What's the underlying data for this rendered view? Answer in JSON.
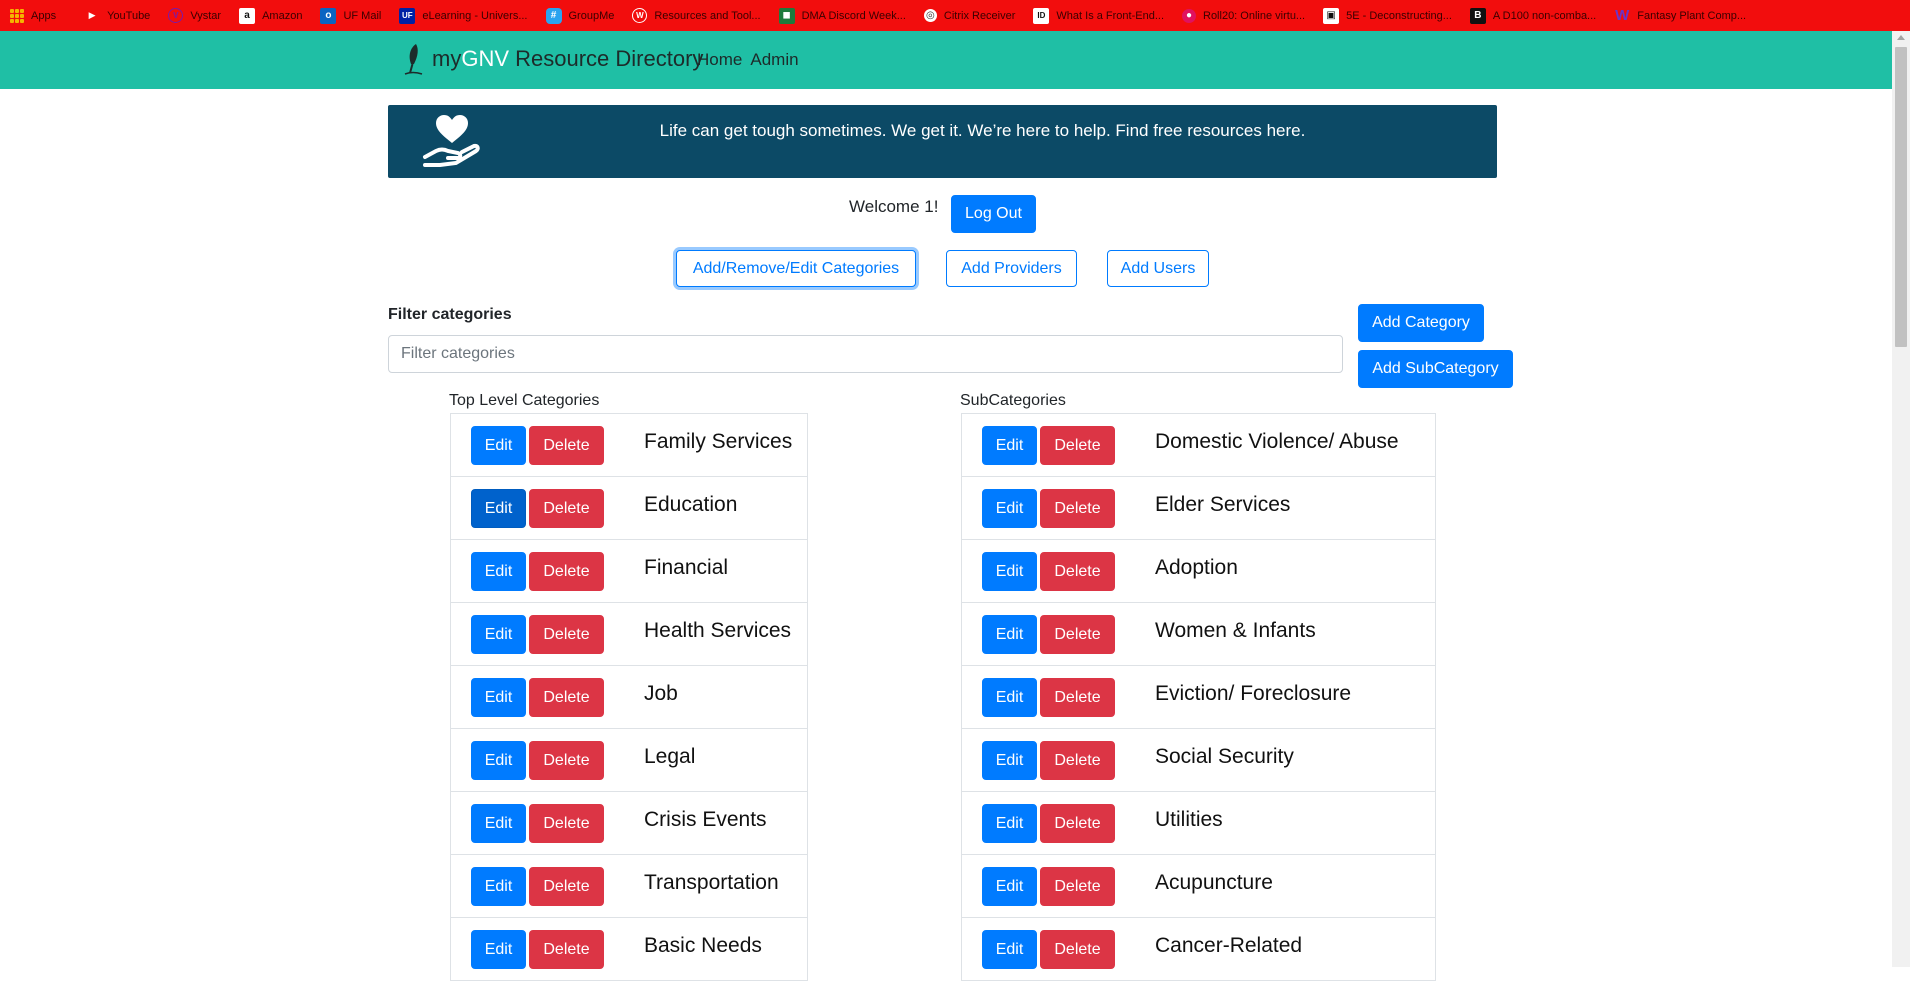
{
  "bookmarks": [
    {
      "label": "Apps",
      "icon": "apps-grid-icon"
    },
    {
      "label": "YouTube",
      "icon": "youtube-icon"
    },
    {
      "label": "Vystar",
      "icon": "vystar-icon"
    },
    {
      "label": "Amazon",
      "icon": "amazon-icon"
    },
    {
      "label": "UF Mail",
      "icon": "outlook-icon"
    },
    {
      "label": "eLearning - Univers...",
      "icon": "uf-icon"
    },
    {
      "label": "GroupMe",
      "icon": "groupme-icon"
    },
    {
      "label": "Resources and Tool...",
      "icon": "wordpress-icon"
    },
    {
      "label": "DMA Discord Week...",
      "icon": "discord-icon"
    },
    {
      "label": "Citrix Receiver",
      "icon": "citrix-icon"
    },
    {
      "label": "What Is a Front-End...",
      "icon": "page-icon"
    },
    {
      "label": "Roll20: Online virtu...",
      "icon": "roll20-icon"
    },
    {
      "label": "5E - Deconstructing...",
      "icon": "book-icon"
    },
    {
      "label": "A D100 non-comba...",
      "icon": "b-icon"
    },
    {
      "label": "Fantasy Plant Comp...",
      "icon": "w-icon"
    }
  ],
  "brand": {
    "prefix": "my",
    "accent": "GNV",
    "suffix": " Resource Directory"
  },
  "nav": {
    "home": "Home",
    "admin": "Admin"
  },
  "banner": {
    "text": "Life can get tough sometimes. We get it. We’re here to help. Find free resources here."
  },
  "welcome": {
    "text": "Welcome 1!",
    "logout": "Log Out"
  },
  "admin_tabs": {
    "categories": "Add/Remove/Edit Categories",
    "providers": "Add Providers",
    "users": "Add Users"
  },
  "filter": {
    "label": "Filter categories",
    "placeholder": "Filter categories",
    "value": ""
  },
  "actions": {
    "add_category": "Add Category",
    "add_subcategory": "Add SubCategory"
  },
  "row_buttons": {
    "edit": "Edit",
    "delete": "Delete"
  },
  "top_level": {
    "header": "Top Level Categories",
    "items": [
      "Family Services",
      "Education",
      "Financial",
      "Health Services",
      "Job",
      "Legal",
      "Crisis Events",
      "Transportation",
      "Basic Needs"
    ]
  },
  "subcategories": {
    "header": "SubCategories",
    "items": [
      "Domestic Violence/ Abuse",
      "Elder Services",
      "Adoption",
      "Women & Infants",
      "Eviction/ Foreclosure",
      "Social Security",
      "Utilities",
      "Acupuncture",
      "Cancer-Related"
    ]
  },
  "colors": {
    "bookmark_bar": "#f20d0d",
    "navbar": "#1fbfa5",
    "banner": "#0c4a66",
    "primary": "#007bff",
    "danger": "#dc3545"
  }
}
